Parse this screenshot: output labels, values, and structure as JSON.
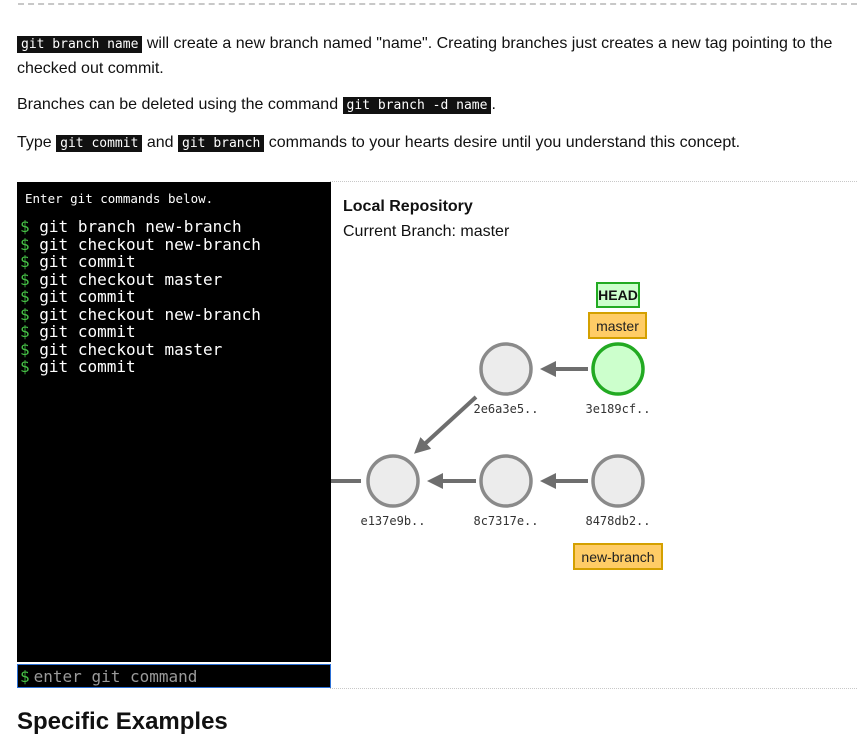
{
  "intro": {
    "para1_code": "git branch name",
    "para1_text": " will create a new branch named \"name\". Creating branches just creates a new tag pointing to the checked out commit.",
    "para2_text": "Branches can be deleted using the command ",
    "para2_code": "git branch -d name",
    "para2_end": ".",
    "para3_start": "Type ",
    "para3_code1": "git commit",
    "para3_mid": " and ",
    "para3_code2": "git branch",
    "para3_end": " commands to your hearts desire until you understand this concept."
  },
  "terminal": {
    "intro": "Enter git commands below.",
    "prompt": "$",
    "history": [
      "git branch new-branch",
      "git checkout new-branch",
      "git commit",
      "git checkout master",
      "git commit",
      "git checkout new-branch",
      "git commit",
      "git checkout master",
      "git commit"
    ],
    "input_placeholder": "enter git command",
    "input_value": ""
  },
  "repo": {
    "title": "Local Repository",
    "current_branch": "Current Branch: master"
  },
  "graph": {
    "head_label": "HEAD",
    "commits": [
      {
        "id": "e137e9b..",
        "current": false
      },
      {
        "id": "8c7317e..",
        "current": false
      },
      {
        "id": "8478db2..",
        "current": false
      },
      {
        "id": "2e6a3e5..",
        "current": false
      },
      {
        "id": "3e189cf..",
        "current": true
      }
    ],
    "branches": [
      {
        "name": "master",
        "commit": "3e189cf.."
      },
      {
        "name": "new-branch",
        "commit": "8478db2.."
      }
    ],
    "colors": {
      "commit_fill": "#ececec",
      "commit_stroke": "#8a8a8a",
      "current_fill": "#ccffcc",
      "current_stroke": "#22aa22",
      "branch_fill": "#ffcc66",
      "branch_stroke": "#d4a000",
      "head_fill": "#ccffcc",
      "head_stroke": "#22aa22",
      "arrow": "#6e6e6e"
    }
  },
  "next_section": {
    "heading": "Specific Examples"
  }
}
